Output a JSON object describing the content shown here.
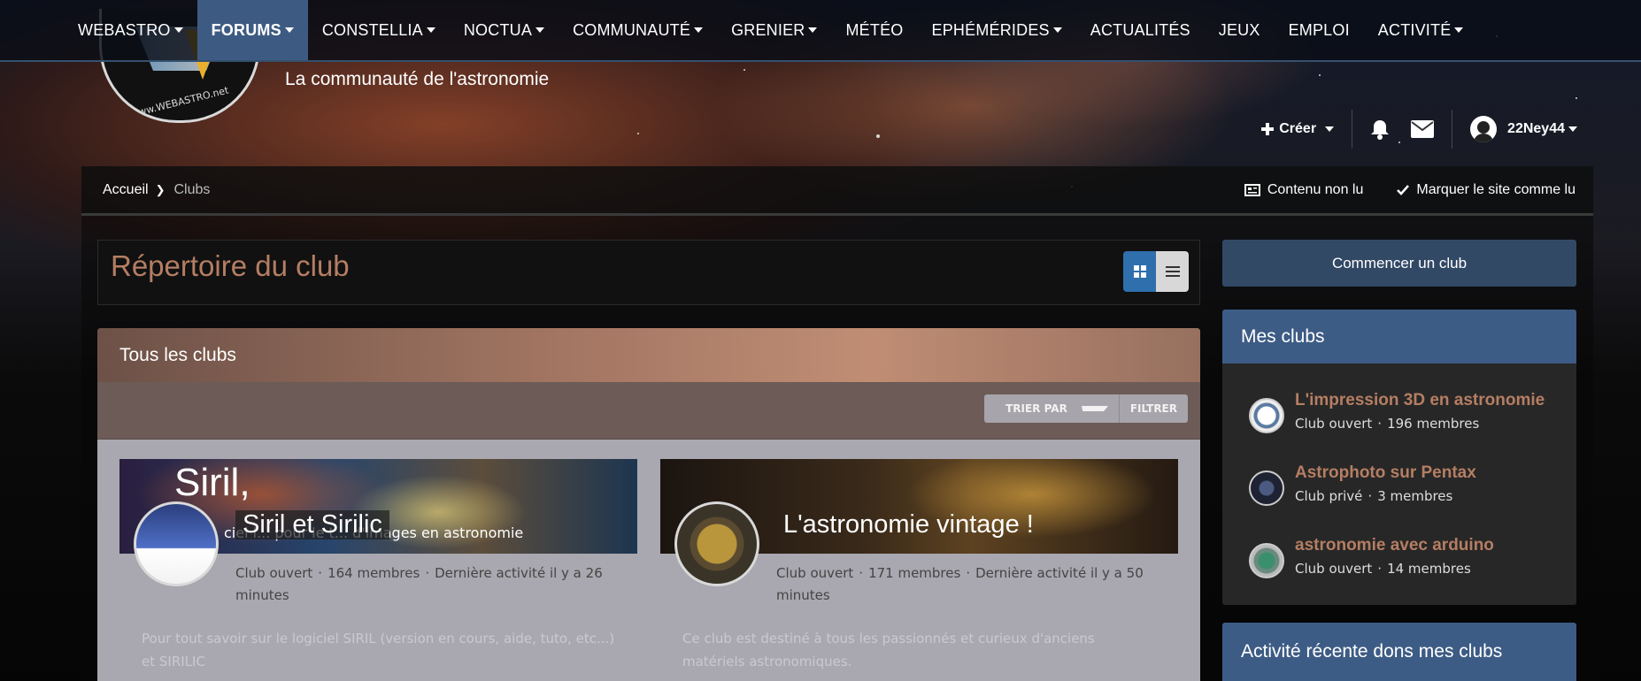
{
  "nav": {
    "items": [
      {
        "label": "WEBASTRO",
        "dropdown": true,
        "active": false
      },
      {
        "label": "FORUMS",
        "dropdown": true,
        "active": true
      },
      {
        "label": "CONSTELLIA",
        "dropdown": true,
        "active": false
      },
      {
        "label": "NOCTUA",
        "dropdown": true,
        "active": false
      },
      {
        "label": "COMMUNAUTÉ",
        "dropdown": true,
        "active": false
      },
      {
        "label": "GRENIER",
        "dropdown": true,
        "active": false
      },
      {
        "label": "MÉTÉO",
        "dropdown": false,
        "active": false
      },
      {
        "label": "EPHÉMÉRIDES",
        "dropdown": true,
        "active": false
      },
      {
        "label": "ACTUALITÉS",
        "dropdown": false,
        "active": false
      },
      {
        "label": "JEUX",
        "dropdown": false,
        "active": false
      },
      {
        "label": "EMPLOI",
        "dropdown": false,
        "active": false
      },
      {
        "label": "ACTIVITÉ",
        "dropdown": true,
        "active": false
      }
    ]
  },
  "header": {
    "logo_text": "www.WEBASTRO.net",
    "tagline": "La communauté de l'astronomie"
  },
  "user_bar": {
    "create_label": "Créer",
    "username": "22Ney44",
    "icons": [
      "plus-icon",
      "bell-icon",
      "envelope-icon",
      "user-avatar"
    ]
  },
  "breadcrumb": {
    "home": "Accueil",
    "current": "Clubs",
    "unread_label": "Contenu non lu",
    "mark_read_label": "Marquer le site comme lu"
  },
  "page": {
    "title": "Répertoire du club"
  },
  "clubs_panel": {
    "title": "Tous les clubs",
    "sort_label": "TRIER PAR",
    "filter_label": "FILTRER",
    "cards": [
      {
        "banner_big": "Siril,",
        "banner_sub": "ciel l... pour le t... d'images en astronomie",
        "title": "Siril et Sirilic",
        "type": "Club ouvert",
        "members": "164 membres",
        "activity": "Dernière activité il y a 26 minutes",
        "description": "Pour tout savoir sur le logiciel SIRIL (version en cours, aide, tuto, etc...) et SIRILIC"
      },
      {
        "title": "L'astronomie vintage !",
        "type": "Club ouvert",
        "members": "171 membres",
        "activity": "Dernière activité il y a 50 minutes",
        "description": "Ce club est destiné à tous les passionnés et curieux d'anciens matériels astronomiques."
      }
    ]
  },
  "sidebar": {
    "start_club_label": "Commencer un club",
    "my_clubs_title": "Mes clubs",
    "my_clubs": [
      {
        "name": "L'impression 3D en astronomie",
        "type": "Club ouvert",
        "members": "196 membres"
      },
      {
        "name": "Astrophoto sur Pentax",
        "type": "Club privé",
        "members": "3 membres"
      },
      {
        "name": "astronomie avec arduino",
        "type": "Club ouvert",
        "members": "14 membres"
      }
    ],
    "recent_title": "Activité récente dons mes clubs"
  },
  "colors": {
    "accent_blue": "#3d5c85",
    "title_copper": "#b57e63",
    "nav_active": "#3d5b82"
  }
}
